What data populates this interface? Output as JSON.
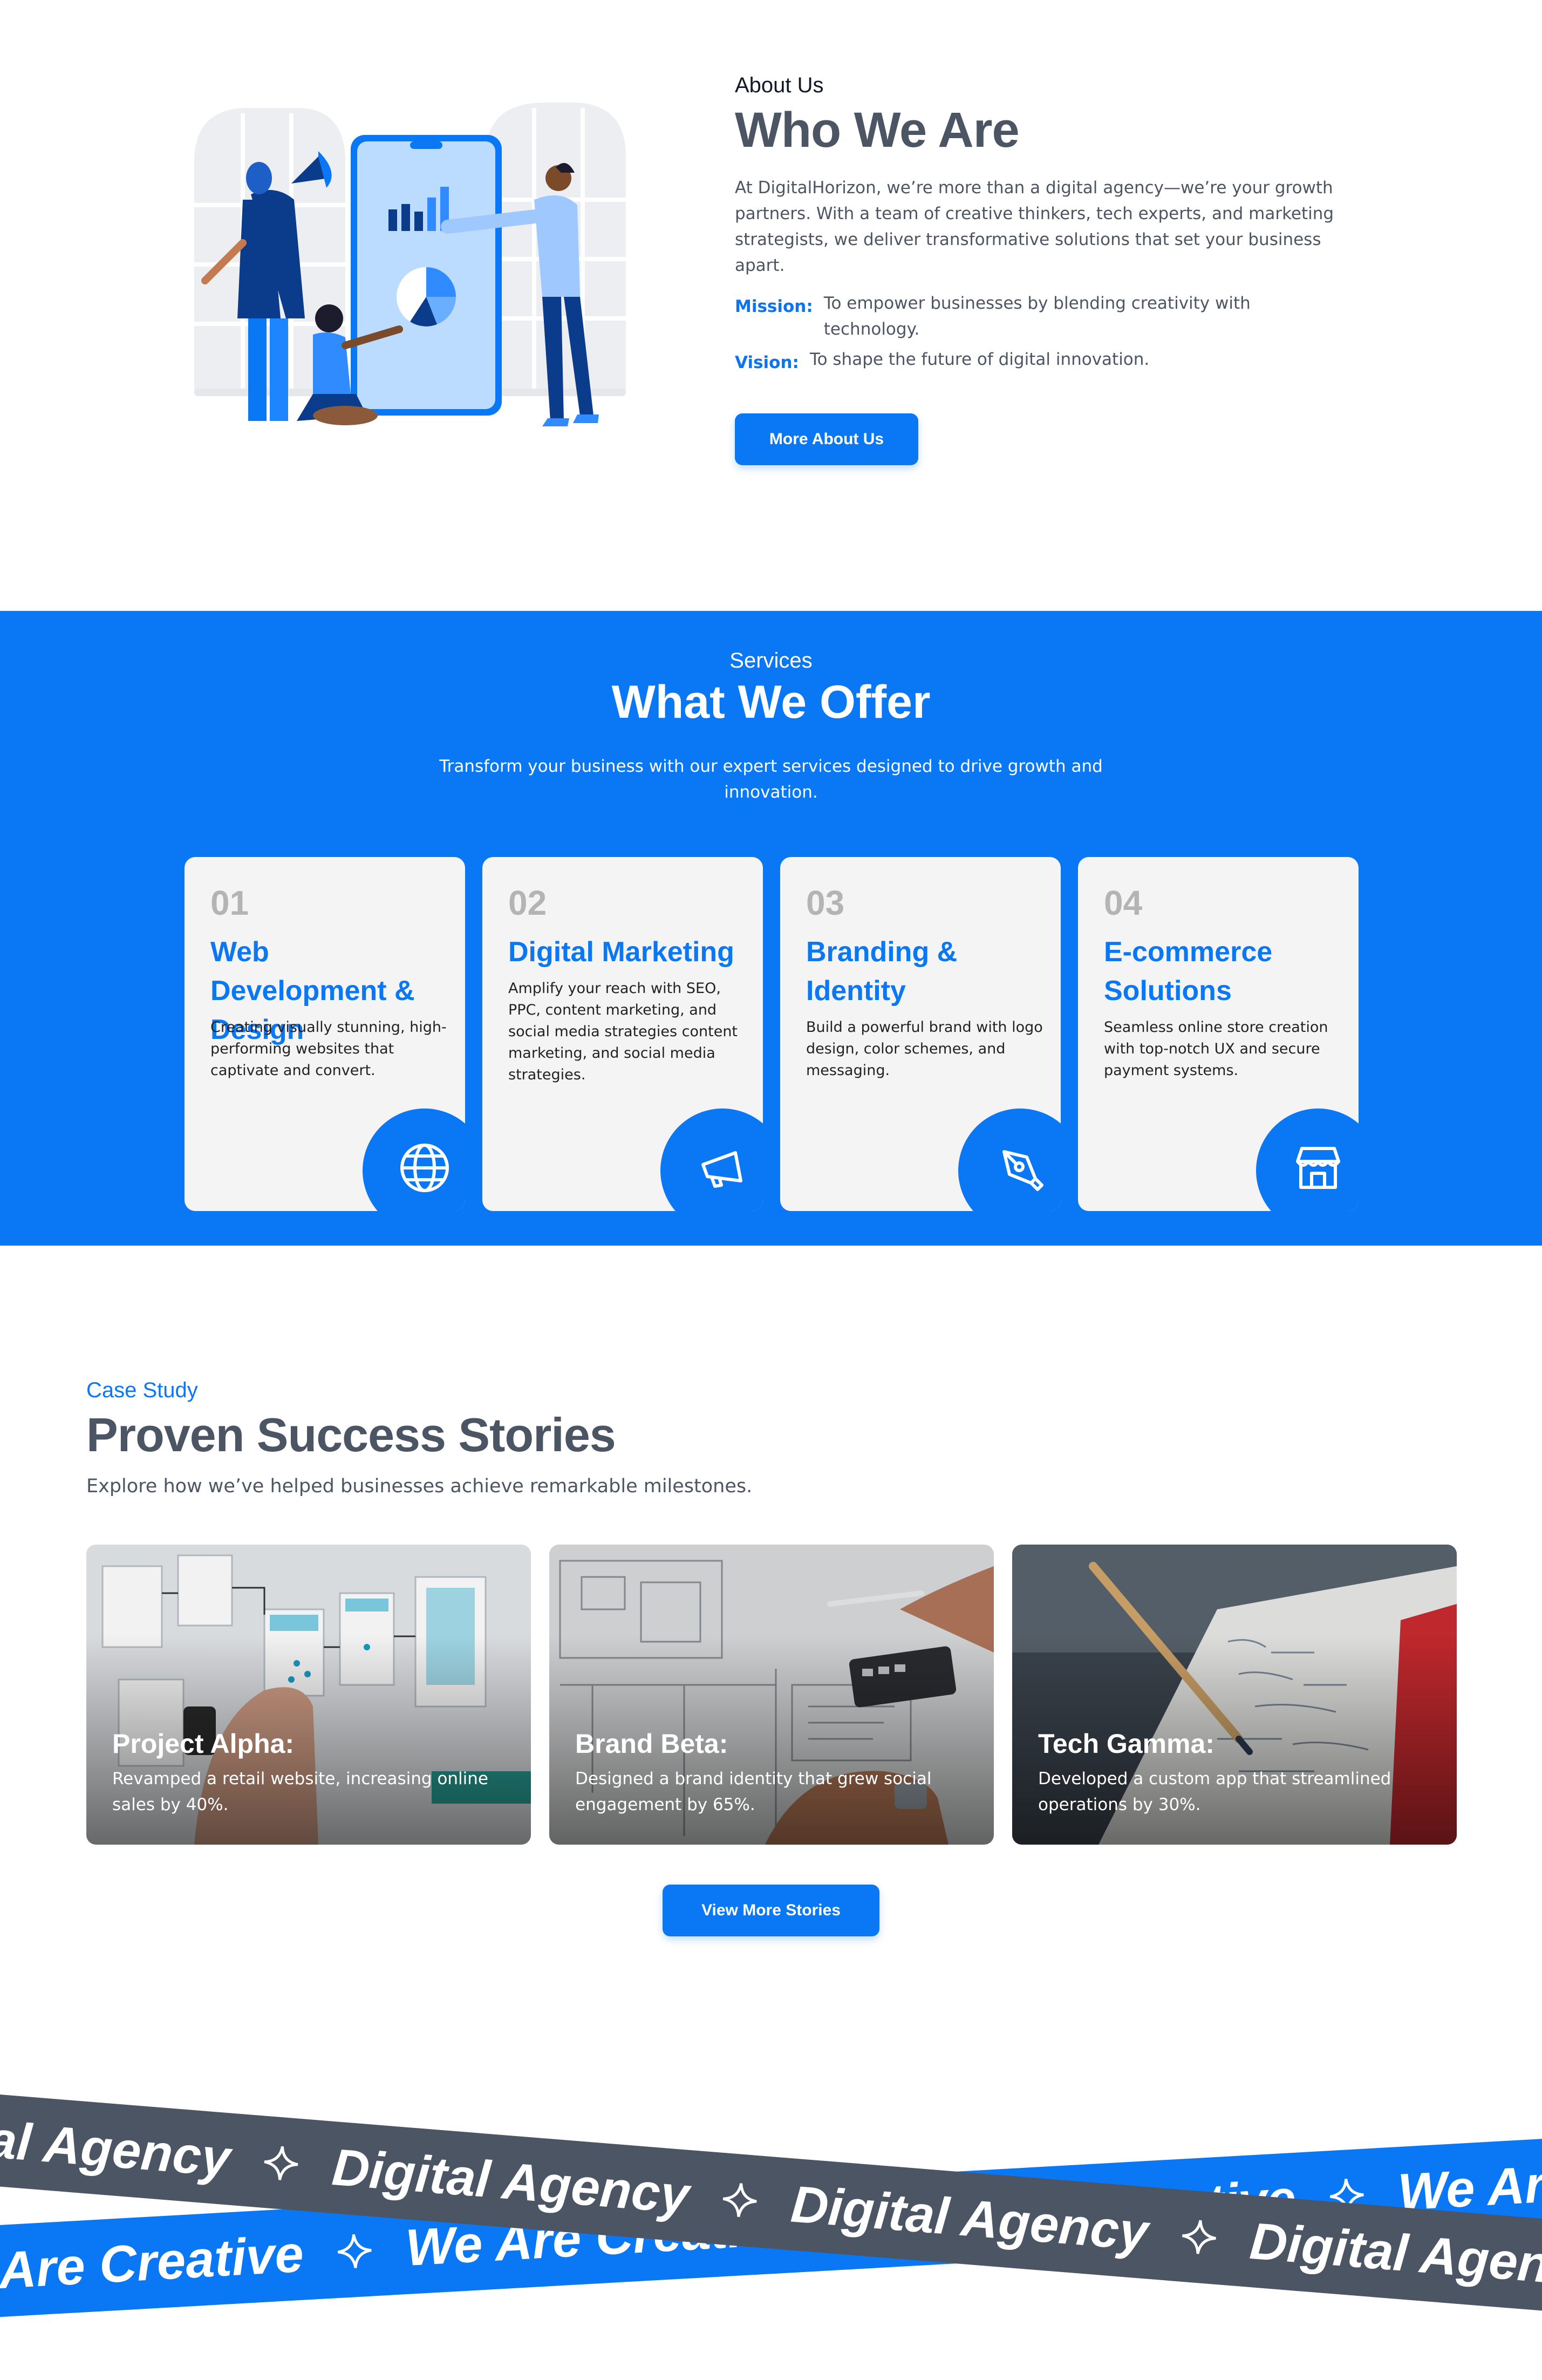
{
  "about": {
    "eyebrow": "About Us",
    "title": "Who We Are",
    "paragraph": "At DigitalHorizon, we’re more than a digital agency—we’re your growth partners. With a team of creative thinkers, tech experts, and marketing strategists, we deliver transformative solutions that set your business apart.",
    "mission_label": "Mission:",
    "mission_text": "To empower businesses by blending creativity with technology.",
    "vision_label": "Vision:",
    "vision_text": "To shape the future of digital innovation.",
    "button": "More About Us"
  },
  "services": {
    "eyebrow": "Services",
    "title": "What We Offer",
    "subtitle": "Transform your business with our expert services designed to drive growth and innovation.",
    "cards": [
      {
        "num": "01",
        "title": "Web Development & Design",
        "desc": "Creating visually stunning, high-performing websites that captivate and convert.",
        "icon": "globe-icon"
      },
      {
        "num": "02",
        "title": "Digital Marketing",
        "desc": "Amplify your reach with SEO, PPC, content marketing, and social media strategies content marketing, and social media strategies.",
        "icon": "megaphone-icon"
      },
      {
        "num": "03",
        "title": "Branding & Identity",
        "desc": "Build a powerful brand with logo design, color schemes, and messaging.",
        "icon": "pen-tool-icon"
      },
      {
        "num": "04",
        "title": "E-commerce Solutions",
        "desc": "Seamless online store creation with top-notch UX and secure payment systems.",
        "icon": "store-icon"
      }
    ]
  },
  "cases": {
    "eyebrow": "Case Study",
    "title": "Proven Success Stories",
    "subtitle": "Explore how we’ve helped businesses achieve remarkable milestones.",
    "items": [
      {
        "name": "Project Alpha:",
        "desc": "Revamped a retail website, increasing online sales by 40%."
      },
      {
        "name": "Brand Beta:",
        "desc": "Designed a brand identity that grew social engagement by 65%."
      },
      {
        "name": "Tech Gamma:",
        "desc": "Developed a custom app that streamlined operations by 30%."
      }
    ],
    "button": "View More Stories"
  },
  "marquee": {
    "blue_word": "We Are Creative",
    "gray_word": "Digital Agency"
  },
  "colors": {
    "primary": "#0a77f5",
    "heading": "#4b5563",
    "card_bg": "#f4f4f5",
    "band_gray": "#4b5563"
  }
}
